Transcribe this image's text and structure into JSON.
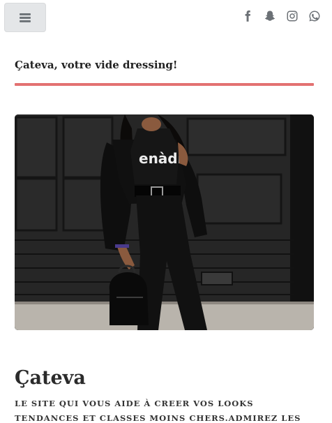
{
  "header": {
    "menu_icon": "hamburger-menu-icon",
    "socials": [
      {
        "name": "facebook",
        "icon": "facebook-icon"
      },
      {
        "name": "snapchat",
        "icon": "snapchat-icon"
      },
      {
        "name": "instagram",
        "icon": "instagram-icon"
      },
      {
        "name": "whatsapp",
        "icon": "whatsapp-icon"
      }
    ]
  },
  "tagline": "Çateva, votre vide dressing!",
  "hero": {
    "shirt_text": "enàdi"
  },
  "site": {
    "title": "Çateva",
    "description": "LE SITE QUI VOUS AIDE À CREER VOS LOOKS TENDANCES ET CLASSES MOINS CHERS.ADMIREZ LES LOOKS ET"
  },
  "colors": {
    "accent": "#e37171",
    "icon_gray": "#6c7176",
    "button_bg": "#e4e6e8"
  }
}
